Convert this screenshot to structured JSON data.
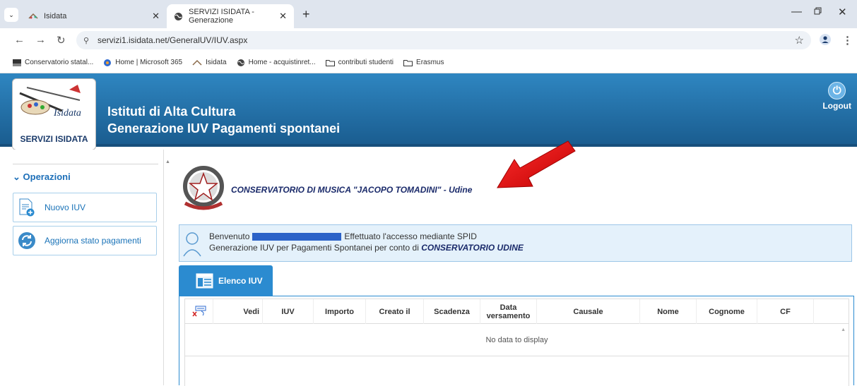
{
  "browser": {
    "tabs": [
      {
        "title": "Isidata"
      },
      {
        "title": "SERVIZI ISIDATA - Generazione"
      }
    ],
    "url": "servizi1.isidata.net/GeneralUV/IUV.aspx",
    "bookmarks": [
      {
        "label": "Conservatorio statal..."
      },
      {
        "label": "Home | Microsoft 365"
      },
      {
        "label": "Isidata"
      },
      {
        "label": "Home - acquistinret..."
      },
      {
        "label": "contributi studenti"
      },
      {
        "label": "Erasmus"
      }
    ]
  },
  "header": {
    "logo_label": "SERVIZI ISIDATA",
    "logo_text": "Isidata",
    "title_line1": "Istituti di Alta Cultura",
    "title_line2": "Generazione IUV Pagamenti spontanei",
    "logout_label": "Logout"
  },
  "sidebar": {
    "section_title": "Operazioni",
    "items": [
      {
        "label": "Nuovo IUV"
      },
      {
        "label": "Aggiorna stato pagamenti"
      }
    ]
  },
  "institution": {
    "name": "CONSERVATORIO DI MUSICA \"JACOPO TOMADINI\" - Udine"
  },
  "welcome": {
    "prefix": "Benvenuto",
    "access_text": "Effettuato l'accesso mediante SPID",
    "line2_prefix": "Generazione IUV per Pagamenti Spontanei per conto di",
    "line2_entity": "CONSERVATORIO UDINE"
  },
  "tab": {
    "label": "Elenco IUV"
  },
  "grid": {
    "columns": [
      "Vedi",
      "IUV",
      "Importo",
      "Creato il",
      "Scadenza",
      "Data versamento",
      "Causale",
      "Nome",
      "Cognome",
      "CF"
    ],
    "empty_text": "No data to display"
  },
  "colors": {
    "banner": "#2f86c1",
    "accent": "#1d6fb8",
    "tab_active": "#2b8bd0",
    "annotation_arrow": "#e01010"
  }
}
